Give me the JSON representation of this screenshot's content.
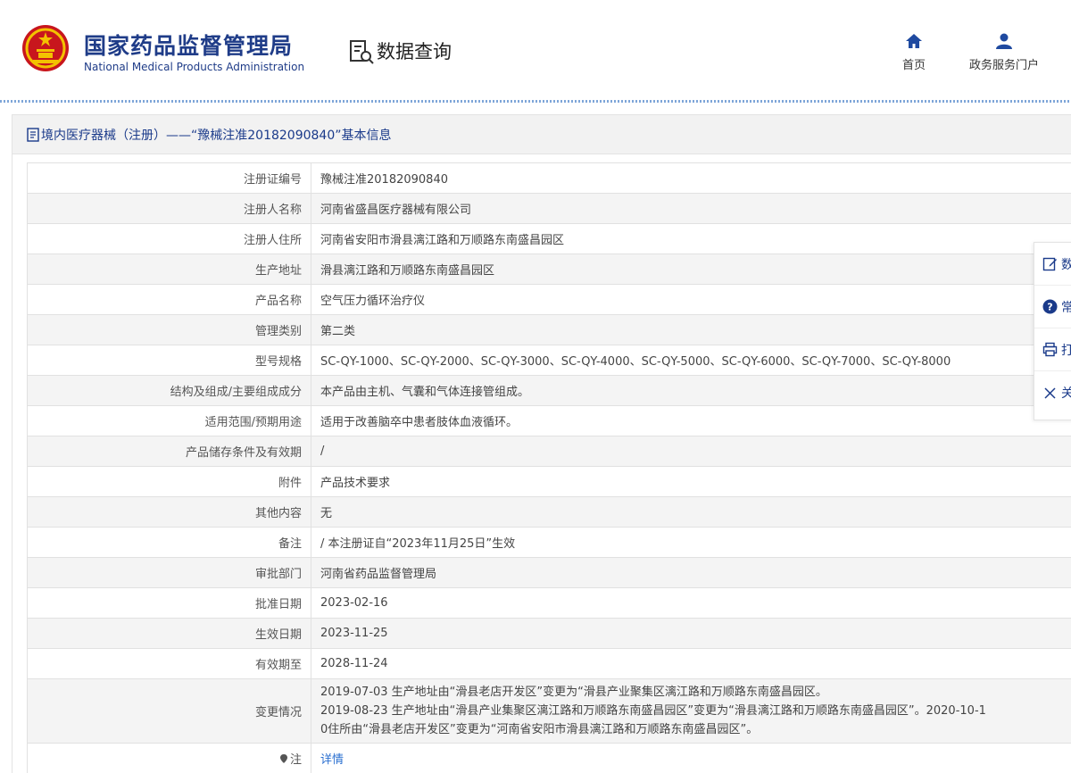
{
  "header": {
    "brand_cn": "国家药品监督管理局",
    "brand_en": "National Medical Products Administration",
    "query_title": "数据查询",
    "nav": [
      {
        "label": "首页",
        "icon": "home-icon"
      },
      {
        "label": "政务服务门户",
        "icon": "user-icon"
      }
    ]
  },
  "panel": {
    "title": "境内医疗器械（注册）——“豫械注准20182090840”基本信息"
  },
  "rows": [
    {
      "label": "注册证编号",
      "value": "豫械注准20182090840"
    },
    {
      "label": "注册人名称",
      "value": "河南省盛昌医疗器械有限公司"
    },
    {
      "label": "注册人住所",
      "value": "河南省安阳市滑县漓江路和万顺路东南盛昌园区"
    },
    {
      "label": "生产地址",
      "value": "滑县漓江路和万顺路东南盛昌园区"
    },
    {
      "label": "产品名称",
      "value": "空气压力循环治疗仪"
    },
    {
      "label": "管理类别",
      "value": "第二类"
    },
    {
      "label": "型号规格",
      "value": "SC-QY-1000、SC-QY-2000、SC-QY-3000、SC-QY-4000、SC-QY-5000、SC-QY-6000、SC-QY-7000、SC-QY-8000"
    },
    {
      "label": "结构及组成/主要组成成分",
      "value": "本产品由主机、气囊和气体连接管组成。"
    },
    {
      "label": "适用范围/预期用途",
      "value": "适用于改善脑卒中患者肢体血液循环。"
    },
    {
      "label": "产品储存条件及有效期",
      "value": "/"
    },
    {
      "label": "附件",
      "value": "产品技术要求"
    },
    {
      "label": "其他内容",
      "value": "无"
    },
    {
      "label": "备注",
      "value": "/ 本注册证自“2023年11月25日”生效"
    },
    {
      "label": "审批部门",
      "value": "河南省药品监督管理局"
    },
    {
      "label": "批准日期",
      "value": "2023-02-16"
    },
    {
      "label": "生效日期",
      "value": "2023-11-25"
    },
    {
      "label": "有效期至",
      "value": "2028-11-24"
    }
  ],
  "change": {
    "label": "变更情况",
    "line1": "2019-07-03 生产地址由“滑县老店开发区”变更为“滑县产业聚集区漓江路和万顺路东南盛昌园区。",
    "line2": "2019-08-23 生产地址由“滑县产业集聚区漓江路和万顺路东南盛昌园区”变更为“滑县漓江路和万顺路东南盛昌园区”。2020-10-1",
    "line3": "0住所由“滑县老店开发区”变更为“河南省安阳市滑县漓江路和万顺路东南盛昌园区”。"
  },
  "note": {
    "label": "注",
    "link": "详情"
  },
  "sidebar": [
    {
      "label": "数",
      "icon": "edit-icon"
    },
    {
      "label": "常",
      "icon": "help-icon"
    },
    {
      "label": "打",
      "icon": "print-icon"
    },
    {
      "label": "关",
      "icon": "close-icon"
    }
  ],
  "colors": {
    "brand": "#1f3c88",
    "link": "#2a6fd0",
    "row_stripe": "#f4f4f4"
  }
}
